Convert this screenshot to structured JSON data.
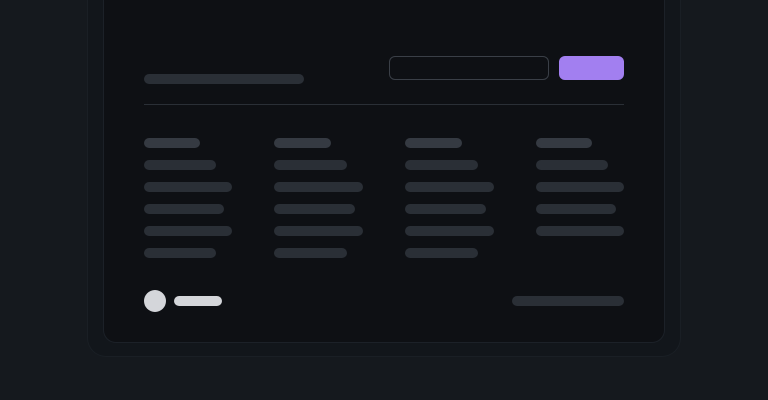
{
  "header": {
    "title": "",
    "search": {
      "value": "",
      "placeholder": ""
    },
    "primary_button_label": "",
    "accent_color": "#a27ff0"
  },
  "table": {
    "columns": [
      {
        "header": "",
        "cells": [
          "",
          "",
          "",
          "",
          ""
        ]
      },
      {
        "header": "",
        "cells": [
          "",
          "",
          "",
          "",
          ""
        ]
      },
      {
        "header": "",
        "cells": [
          "",
          "",
          "",
          "",
          ""
        ]
      },
      {
        "header": "",
        "cells": [
          "",
          "",
          "",
          ""
        ]
      }
    ]
  },
  "footer": {
    "user_name": "",
    "status_text": ""
  }
}
